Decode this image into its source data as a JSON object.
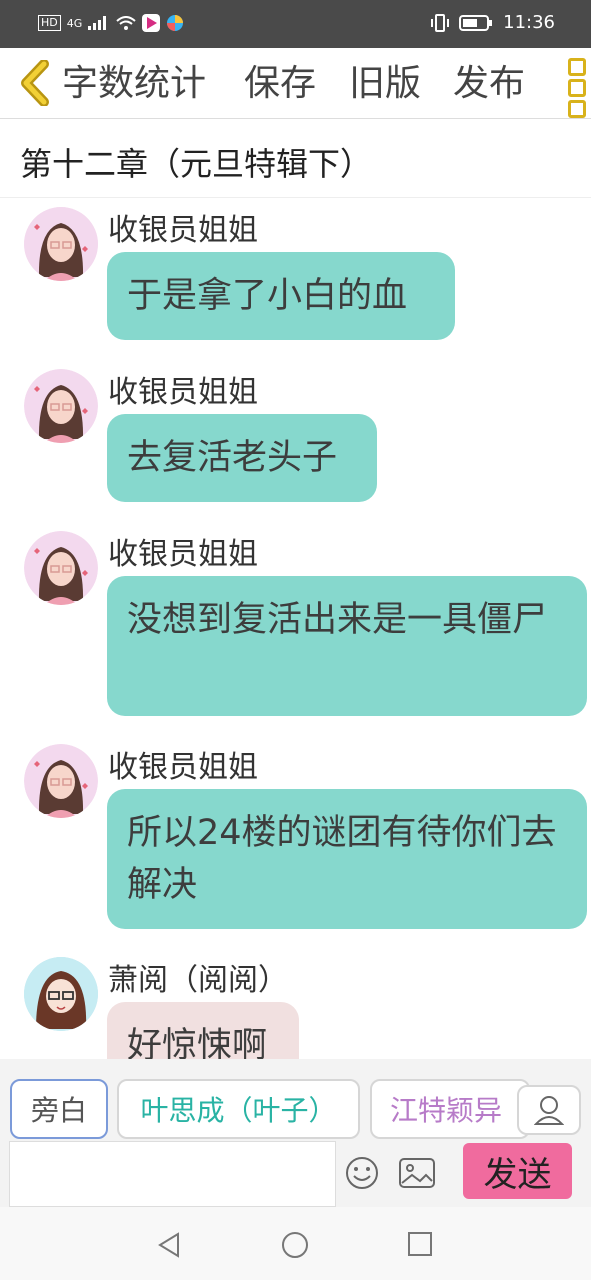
{
  "status_bar": {
    "hd": "HD",
    "network": "4G",
    "time": "11:36"
  },
  "toolbar": {
    "word_count": "字数统计",
    "save": "保存",
    "old_version": "旧版",
    "publish": "发布"
  },
  "chapter_title": "第十二章（元旦特辑下）",
  "messages": [
    {
      "author": "收银员姐姐",
      "text": "于是拿了小白的血"
    },
    {
      "author": "收银员姐姐",
      "text": "去复活老头子"
    },
    {
      "author": "收银员姐姐",
      "text": "没想到复活出来是一具僵尸"
    },
    {
      "author": "收银员姐姐",
      "text": "所以24楼的谜团有待你们去解决"
    },
    {
      "author": "萧阅（阅阅）",
      "text": "好惊悚啊"
    }
  ],
  "composer": {
    "chips": [
      "旁白",
      "叶思成（叶子）",
      "江特颖异"
    ],
    "send": "发送"
  }
}
